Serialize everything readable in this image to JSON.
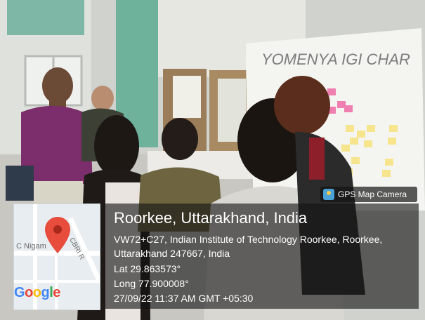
{
  "photo": {
    "description_icon": "photo-scene",
    "chart_paper_text": "YOMENYA IGI CHAR"
  },
  "badge": {
    "icon": "camera-pin-icon",
    "label": "GPS Map Camera"
  },
  "map": {
    "street_1": "C Nigam",
    "street_2": "CBRI R",
    "logo_letters": [
      "G",
      "o",
      "o",
      "g",
      "l",
      "e"
    ],
    "logo_colors": [
      "#4285F4",
      "#EA4335",
      "#FBBC05",
      "#4285F4",
      "#34A853",
      "#EA4335"
    ],
    "pin_color": "#E74C3C"
  },
  "stamp": {
    "title": "Roorkee, Uttarakhand, India",
    "address_line1": "VW72+C27, Indian Institute of Technology Roorkee, Roorkee,",
    "address_line2": "Uttarakhand 247667, India",
    "lat": "Lat 29.863573°",
    "long": "Long 77.900008°",
    "datetime": "27/09/22 11:37 AM GMT +05:30"
  }
}
